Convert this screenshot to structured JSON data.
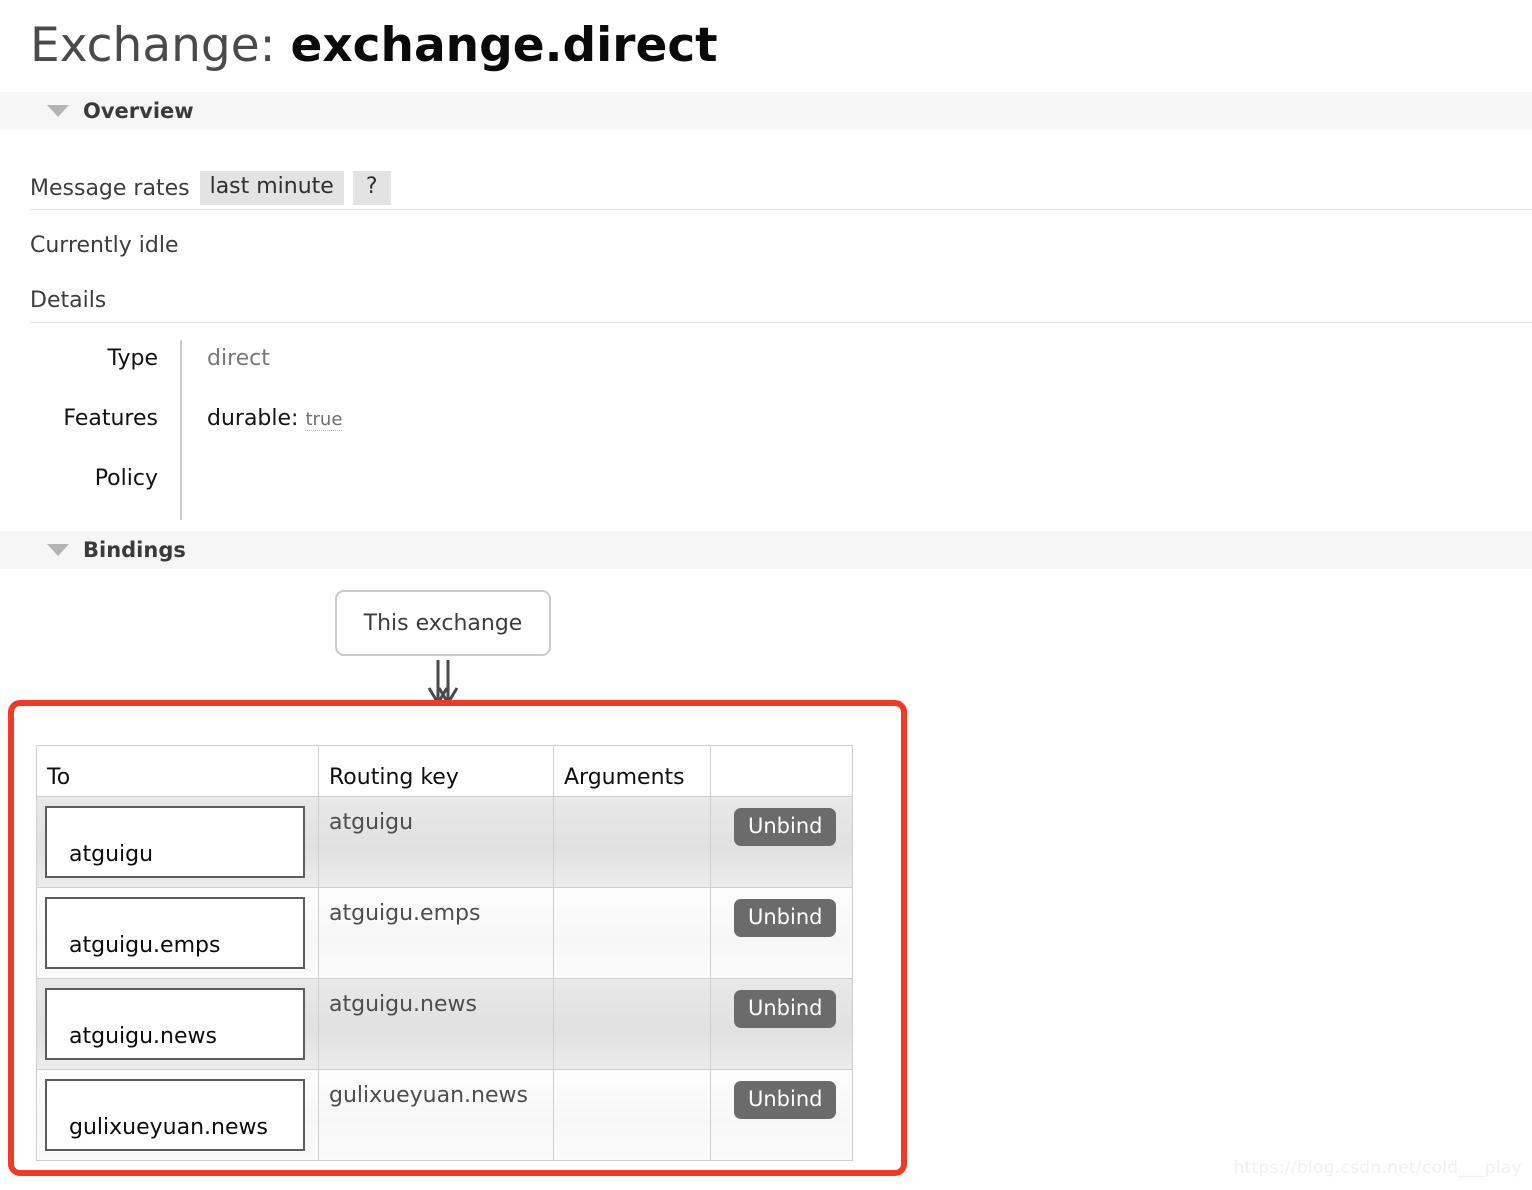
{
  "page": {
    "title_label": "Exchange:",
    "title_name": "exchange.direct",
    "watermark": "https://blog.csdn.net/cold___play"
  },
  "overview": {
    "header": "Overview",
    "collapse_icon": "triangle-down-icon",
    "rates_label": "Message rates",
    "rates_period": "last minute",
    "help_badge": "?",
    "idle_text": "Currently idle",
    "details_label": "Details",
    "details": [
      {
        "key": "Type",
        "value": "direct",
        "kind": "muted"
      },
      {
        "key": "Features",
        "feat_key": "durable:",
        "feat_val": "true",
        "kind": "feature"
      },
      {
        "key": "Policy",
        "value": "",
        "kind": "empty"
      }
    ]
  },
  "bindings": {
    "header": "Bindings",
    "collapse_icon": "triangle-down-icon",
    "source_box": "This exchange",
    "arrow_icon": "double-arrow-down-icon",
    "columns": [
      "To",
      "Routing key",
      "Arguments",
      ""
    ],
    "rows": [
      {
        "to": "atguigu",
        "routing_key": "atguigu",
        "arguments": "",
        "action": "Unbind"
      },
      {
        "to": "atguigu.emps",
        "routing_key": "atguigu.emps",
        "arguments": "",
        "action": "Unbind"
      },
      {
        "to": "atguigu.news",
        "routing_key": "atguigu.news",
        "arguments": "",
        "action": "Unbind"
      },
      {
        "to": "gulixueyuan.news",
        "routing_key": "gulixueyuan.news",
        "arguments": "",
        "action": "Unbind"
      }
    ]
  },
  "colors": {
    "annotation": "#ef3b26",
    "section_header_bg": "#f6f6f6",
    "badge_bg": "#e3e3e3",
    "unbind_bg": "#6b6b6b"
  }
}
